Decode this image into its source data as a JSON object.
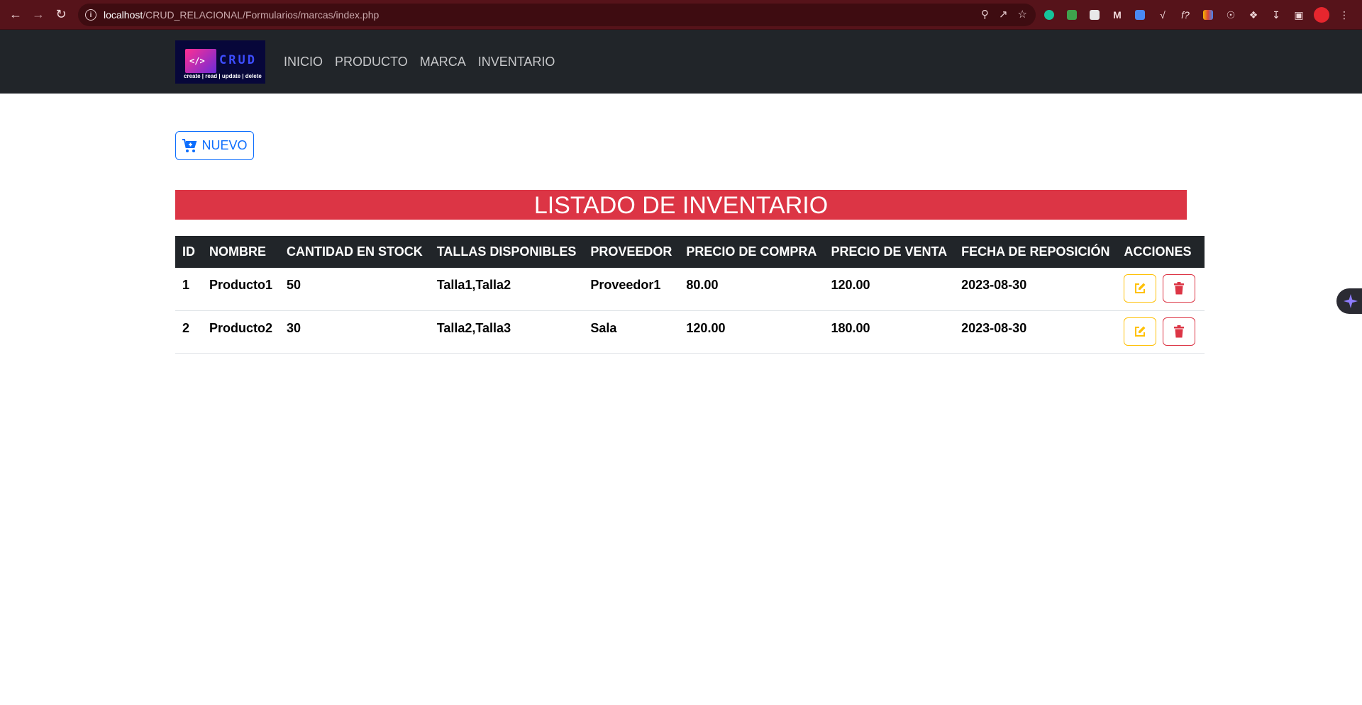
{
  "browser": {
    "url_host": "localhost",
    "url_path": "/CRUD_RELACIONAL/Formularios/marcas/index.php"
  },
  "logo": {
    "title": "CRUD",
    "subtitle": "create | read | update | delete",
    "code_glyph": "</>"
  },
  "nav": {
    "items": [
      "INICIO",
      "PRODUCTO",
      "MARCA",
      "INVENTARIO"
    ]
  },
  "new_button": {
    "label": "NUEVO",
    "icon": "cart-plus-icon"
  },
  "banner": {
    "title": "LISTADO DE INVENTARIO"
  },
  "table": {
    "headers": [
      "ID",
      "NOMBRE",
      "CANTIDAD EN STOCK",
      "TALLAS DISPONIBLES",
      "PROVEEDOR",
      "PRECIO DE COMPRA",
      "PRECIO DE VENTA",
      "FECHA DE REPOSICIÓN",
      "ACCIONES"
    ],
    "rows": [
      {
        "id": "1",
        "nombre": "Producto1",
        "cantidad": "50",
        "tallas": "Talla1,Talla2",
        "proveedor": "Proveedor1",
        "precio_compra": "80.00",
        "precio_venta": "120.00",
        "fecha": "2023-08-30"
      },
      {
        "id": "2",
        "nombre": "Producto2",
        "cantidad": "30",
        "tallas": "Talla2,Talla3",
        "proveedor": "Sala",
        "precio_compra": "120.00",
        "precio_venta": "180.00",
        "fecha": "2023-08-30"
      }
    ]
  },
  "colors": {
    "primary": "#0d6efd",
    "danger": "#dc3545",
    "warning": "#ffc107",
    "dark": "#212529"
  }
}
